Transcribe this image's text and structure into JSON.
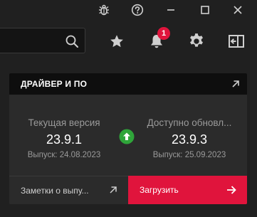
{
  "toolbar": {
    "search_value": "",
    "notification_count": "1"
  },
  "card": {
    "title": "ДРАЙВЕР И ПО",
    "current": {
      "label": "Текущая версия",
      "version": "23.9.1",
      "date": "Выпуск: 24.08.2023"
    },
    "available": {
      "label": "Доступно обновл...",
      "version": "23.9.3",
      "date": "Выпуск: 25.09.2023"
    },
    "notes_label": "Заметки о выпу...",
    "download_label": "Загрузить"
  },
  "colors": {
    "accent": "#e0143c",
    "update_green": "#2fa53a",
    "background": "#202020",
    "card": "#2b2b2b"
  },
  "icons": [
    "bug-icon",
    "help-icon",
    "minimize-icon",
    "maximize-icon",
    "close-icon",
    "search-icon",
    "star-icon",
    "bell-icon",
    "gear-icon",
    "sign-out-icon",
    "external-link-icon",
    "arrow-up-icon",
    "arrow-right-icon"
  ]
}
